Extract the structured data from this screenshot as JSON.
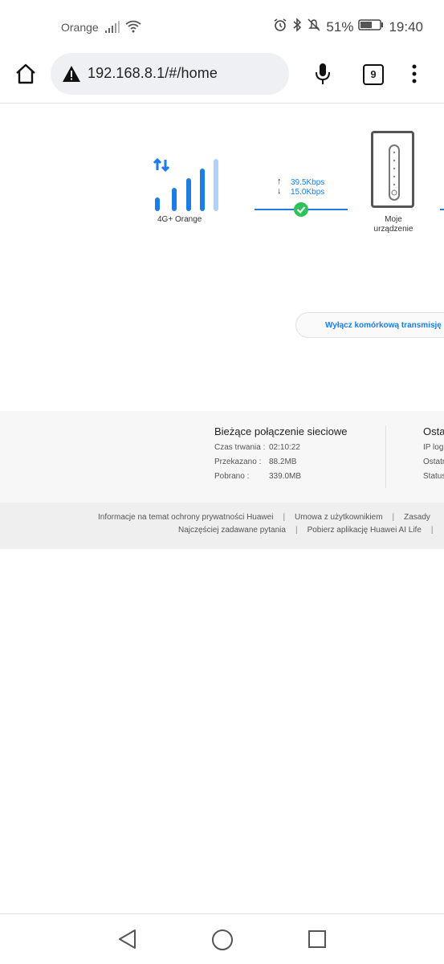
{
  "status_bar": {
    "carrier": "Orange",
    "battery": "51%",
    "time": "19:40",
    "icons": [
      "signal-icon",
      "wifi-icon",
      "alarm-icon",
      "bluetooth-icon",
      "mute-icon",
      "battery-icon"
    ]
  },
  "browser": {
    "url": "192.168.8.1/#/home",
    "tab_count": "9"
  },
  "diagram": {
    "network_label": "4G+ Orange",
    "upload_rate": "39.5Kbps",
    "download_rate": "15.0Kbps",
    "device_label_line1": "Moje",
    "device_label_line2": "urządzenie",
    "accent_color": "#1a7ee6",
    "ok_color": "#2ec25a"
  },
  "toggle": {
    "label": "Wyłącz komórkową transmisję d"
  },
  "connection_info": {
    "title": "Bieżące połączenie sieciowe",
    "rows": [
      {
        "key": "Czas trwania :",
        "value": "02:10:22"
      },
      {
        "key": "Przekazano :",
        "value": "88.2MB"
      },
      {
        "key": "Pobrano :",
        "value": "339.0MB"
      }
    ]
  },
  "second_column": {
    "title": "Osta",
    "rows": [
      "IP log",
      "Ostatn",
      "Status"
    ]
  },
  "footer": {
    "links_row1": [
      "Informacje na temat ochrony prywatności Huawei",
      "Umowa z użytkownikiem",
      "Zasady"
    ],
    "links_row2": [
      "Najczęściej zadawane pytania",
      "Pobierz aplikację Huawei AI Life"
    ]
  }
}
